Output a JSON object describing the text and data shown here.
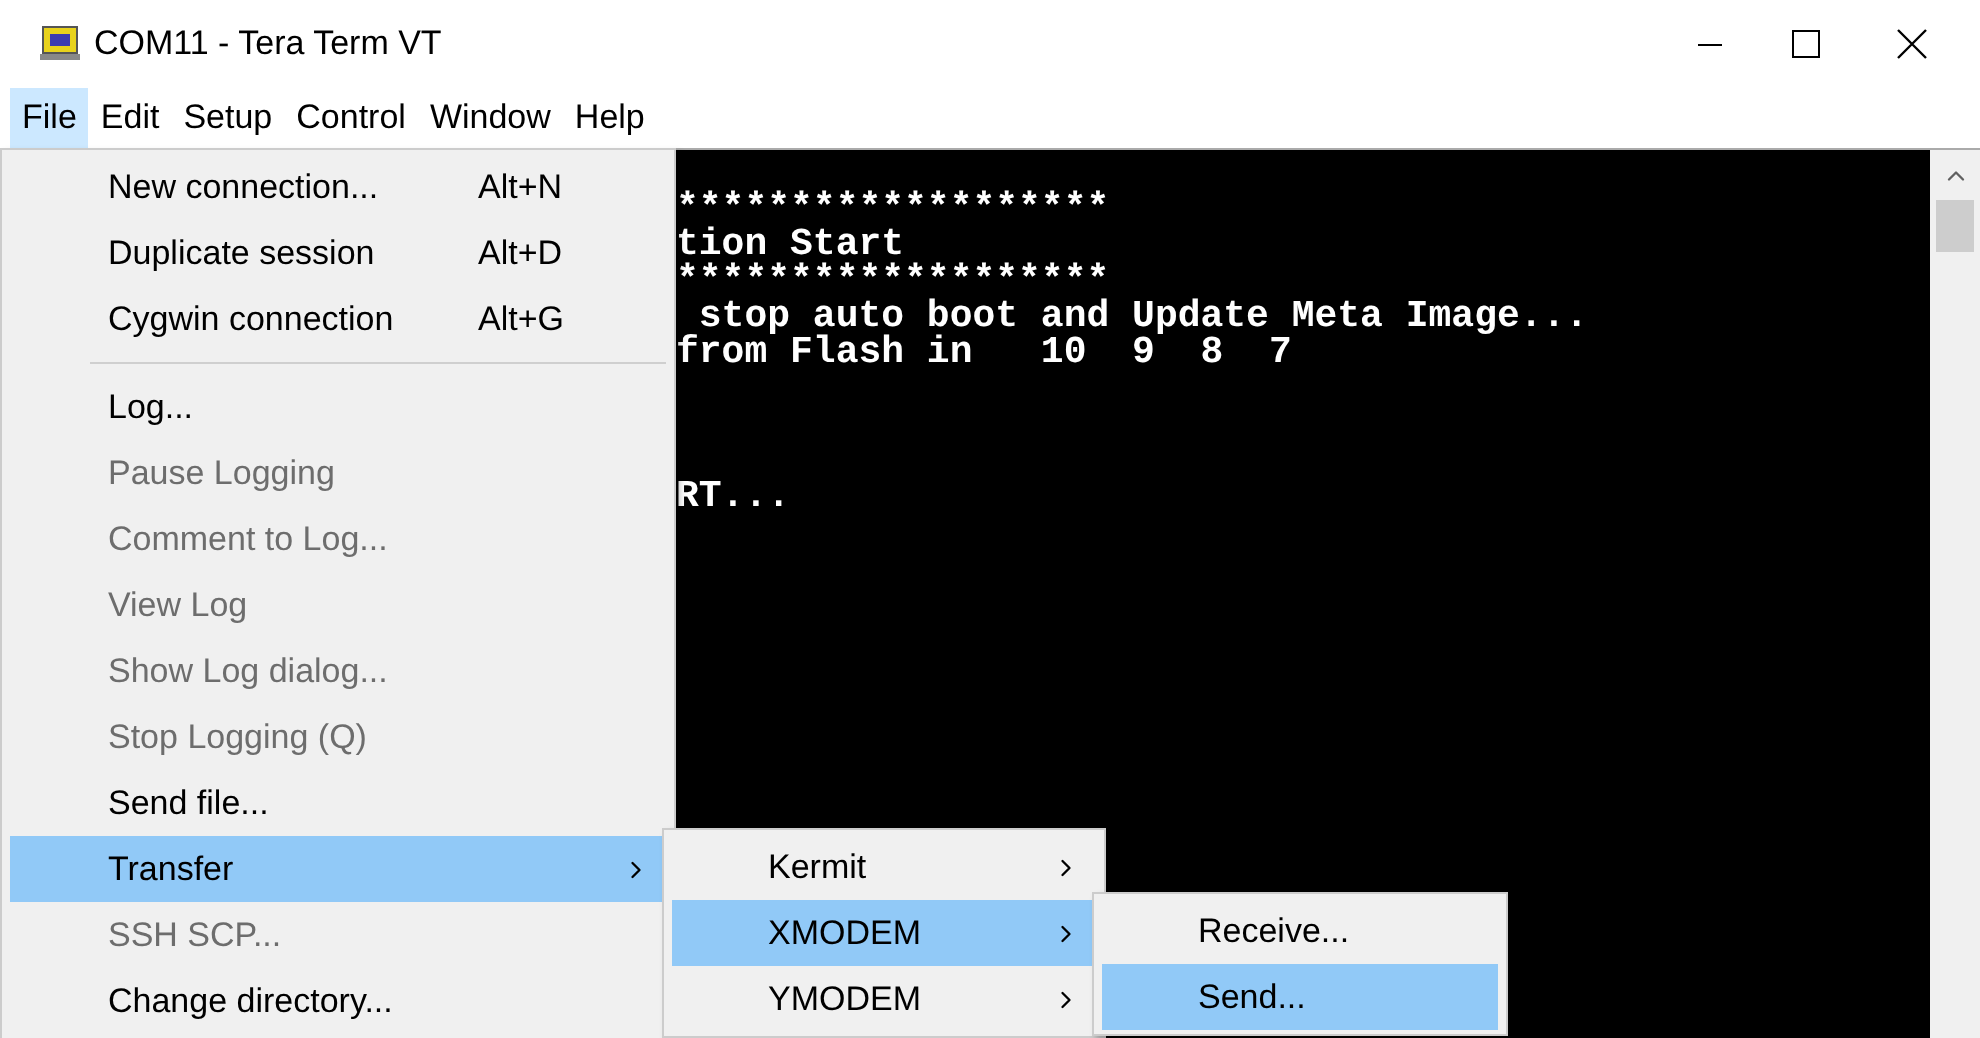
{
  "window": {
    "title": "COM11 - Tera Term VT"
  },
  "menubar": [
    {
      "label": "File",
      "selected": true
    },
    {
      "label": "Edit",
      "selected": false
    },
    {
      "label": "Setup",
      "selected": false
    },
    {
      "label": "Control",
      "selected": false
    },
    {
      "label": "Window",
      "selected": false
    },
    {
      "label": "Help",
      "selected": false
    }
  ],
  "terminal": {
    "lines": [
      {
        "kind": "line",
        "text": "*******************"
      },
      {
        "kind": "line",
        "text": "tion Start"
      },
      {
        "kind": "line",
        "text": "*******************"
      },
      {
        "kind": "line",
        "text": " stop auto boot and Update Meta Image..."
      },
      {
        "kind": "line",
        "text": "from Flash in   10  9  8  7"
      },
      {
        "kind": "after_blank_lines",
        "text": "RT..."
      }
    ]
  },
  "file_menu": [
    {
      "kind": "item",
      "label": "New connection...",
      "shortcut": "Alt+N",
      "disabled": false,
      "selected": false
    },
    {
      "kind": "item",
      "label": "Duplicate session",
      "shortcut": "Alt+D",
      "disabled": false,
      "selected": false
    },
    {
      "kind": "item",
      "label": "Cygwin connection",
      "shortcut": "Alt+G",
      "disabled": false,
      "selected": false
    },
    {
      "kind": "separator"
    },
    {
      "kind": "item",
      "label": "Log...",
      "disabled": false,
      "selected": false
    },
    {
      "kind": "item",
      "label": "Pause Logging",
      "disabled": true,
      "selected": false
    },
    {
      "kind": "item",
      "label": "Comment to Log...",
      "disabled": true,
      "selected": false
    },
    {
      "kind": "item",
      "label": "View Log",
      "disabled": true,
      "selected": false
    },
    {
      "kind": "item",
      "label": "Show Log dialog...",
      "disabled": true,
      "selected": false
    },
    {
      "kind": "item",
      "label": "Stop Logging (Q)",
      "disabled": true,
      "selected": false
    },
    {
      "kind": "item",
      "label": "Send file...",
      "disabled": false,
      "selected": false
    },
    {
      "kind": "submenu",
      "label": "Transfer",
      "disabled": false,
      "selected": true,
      "children": [
        {
          "kind": "submenu",
          "label": "Kermit",
          "disabled": false,
          "selected": false
        },
        {
          "kind": "submenu",
          "label": "XMODEM",
          "disabled": false,
          "selected": true,
          "children": [
            {
              "kind": "item",
              "label": "Receive...",
              "disabled": false,
              "selected": false
            },
            {
              "kind": "item",
              "label": "Send...",
              "disabled": false,
              "selected": true
            }
          ]
        },
        {
          "kind": "submenu",
          "label": "YMODEM",
          "disabled": false,
          "selected": false
        }
      ]
    },
    {
      "kind": "item",
      "label": "SSH SCP...",
      "disabled": true,
      "selected": false
    },
    {
      "kind": "item",
      "label": "Change directory...",
      "disabled": false,
      "selected": false
    }
  ]
}
